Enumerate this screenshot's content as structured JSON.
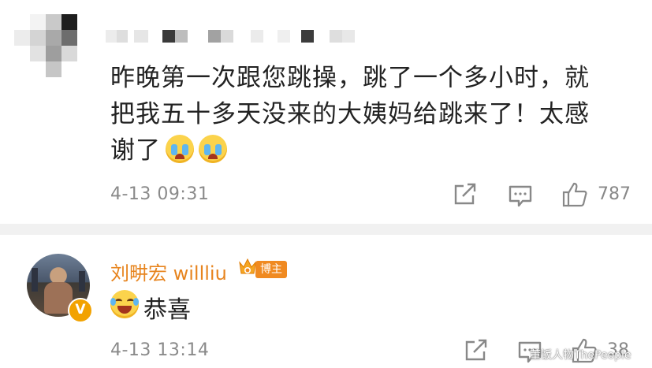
{
  "comment_1": {
    "text_lines": [
      "昨晚第一次跟您跳操，跳了一个多小时，就",
      "把我五十多天没来的大姨妈给跳来了！太感",
      "谢了"
    ],
    "emojis": [
      "crying-face-icon",
      "crying-face-icon"
    ],
    "time": "4-13 09:31",
    "like_count": "787"
  },
  "comment_2": {
    "username": "刘畊宏 willliu",
    "badge": "博主",
    "avatar_badge": "V",
    "emoji": "laughing-tears-icon",
    "text": "恭喜",
    "time": "4-13 13:14",
    "like_count": "38"
  },
  "watermark": "董饭人物ThePeople",
  "colors": {
    "text": "#222222",
    "meta": "#8a8a8a",
    "username": "#e7841e",
    "badge": "#f08a21",
    "divider": "#f1f1f1"
  }
}
